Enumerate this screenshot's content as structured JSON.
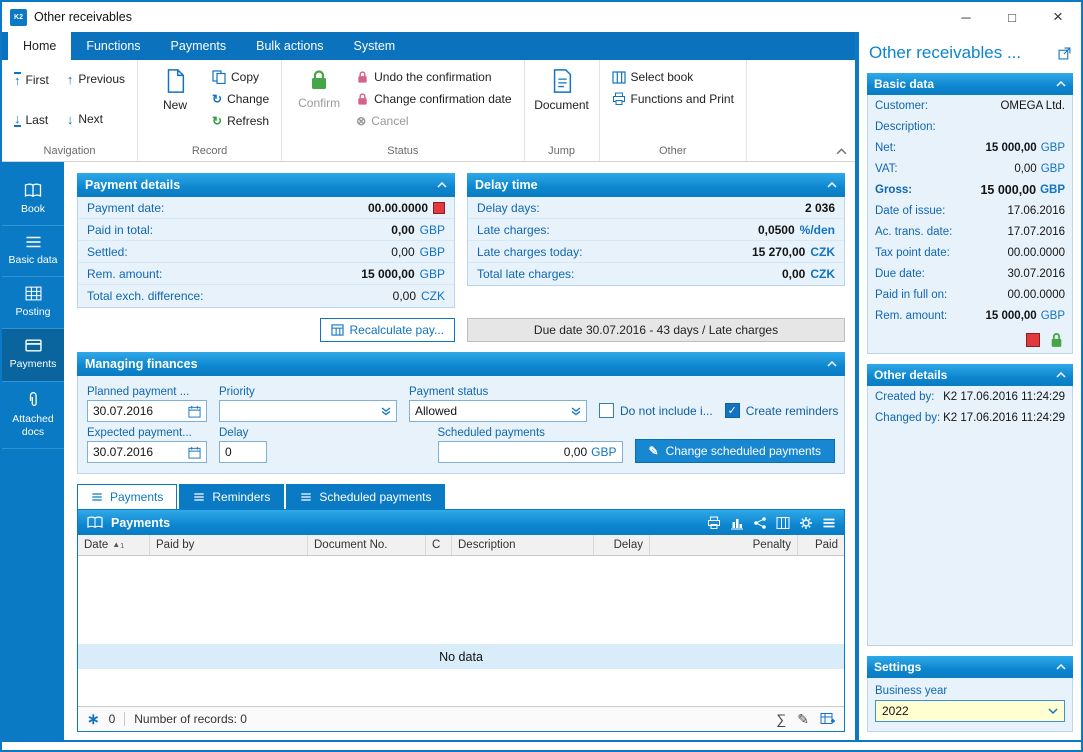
{
  "window": {
    "title": "Other receivables",
    "app_badge": "K2"
  },
  "icons": {
    "minimize": "─",
    "maximize": "□",
    "close": "×",
    "arrow_up": "↑",
    "arrow_down": "↓",
    "refresh": "↻",
    "cancel": "⊗",
    "sort_asc": "▲",
    "sigma": "∑",
    "pencil": "✎",
    "snowflake": "∗"
  },
  "menu": {
    "home": "Home",
    "functions": "Functions",
    "payments": "Payments",
    "bulk_actions": "Bulk actions",
    "system": "System"
  },
  "ribbon": {
    "navigation": {
      "label": "Navigation",
      "first": "First",
      "previous": "Previous",
      "last": "Last",
      "next": "Next"
    },
    "record": {
      "label": "Record",
      "new": "New",
      "copy": "Copy",
      "change": "Change",
      "refresh": "Refresh"
    },
    "status": {
      "label": "Status",
      "confirm": "Confirm",
      "undo": "Undo the confirmation",
      "change_date": "Change confirmation date",
      "cancel": "Cancel"
    },
    "jump": {
      "label": "Jump",
      "document": "Document"
    },
    "other": {
      "label": "Other",
      "select_book": "Select book",
      "functions_print": "Functions and Print"
    }
  },
  "sidebar": {
    "items": [
      {
        "label": "Book"
      },
      {
        "label": "Basic data"
      },
      {
        "label": "Posting"
      },
      {
        "label": "Payments"
      },
      {
        "label": "Attached docs"
      }
    ]
  },
  "payment_details": {
    "title": "Payment details",
    "payment_date": {
      "label": "Payment date:",
      "value": "00.00.0000"
    },
    "paid_in_total": {
      "label": "Paid in total:",
      "value": "0,00",
      "unit": "GBP"
    },
    "settled": {
      "label": "Settled:",
      "value": "0,00",
      "unit": "GBP"
    },
    "rem_amount": {
      "label": "Rem. amount:",
      "value": "15 000,00",
      "unit": "GBP"
    },
    "total_exch": {
      "label": "Total exch. difference:",
      "value": "0,00",
      "unit": "CZK"
    },
    "recalculate_label": "Recalculate pay..."
  },
  "delay_time": {
    "title": "Delay time",
    "delay_days": {
      "label": "Delay days:",
      "value": "2 036"
    },
    "late_charges": {
      "label": "Late charges:",
      "value": "0,0500",
      "unit": "%/den"
    },
    "late_charges_today": {
      "label": "Late charges today:",
      "value": "15 270,00",
      "unit": "CZK"
    },
    "total_late_charges": {
      "label": "Total late charges:",
      "value": "0,00",
      "unit": "CZK"
    },
    "due_banner": "Due date 30.07.2016 - 43 days / Late charges"
  },
  "managing_finances": {
    "title": "Managing finances",
    "planned_payment": {
      "label": "Planned payment ...",
      "value": "30.07.2016"
    },
    "priority": {
      "label": "Priority",
      "value": ""
    },
    "payment_status": {
      "label": "Payment status",
      "value": "Allowed"
    },
    "do_not_include": {
      "label": "Do not include i...",
      "checked": false
    },
    "create_reminders": {
      "label": "Create reminders",
      "checked": true
    },
    "expected_payment": {
      "label": "Expected payment...",
      "value": "30.07.2016"
    },
    "delay": {
      "label": "Delay",
      "value": "0"
    },
    "scheduled_payments": {
      "label": "Scheduled payments",
      "value": "0,00",
      "unit": "GBP"
    },
    "change_scheduled_label": "Change scheduled payments"
  },
  "tabs": {
    "payments": "Payments",
    "reminders": "Reminders",
    "scheduled": "Scheduled payments"
  },
  "grid": {
    "title": "Payments",
    "columns": [
      "Date",
      "Paid by",
      "Document No.",
      "C",
      "Description",
      "Delay",
      "Penalty",
      "Paid"
    ],
    "sort_order": "1",
    "empty_text": "No data",
    "footer": {
      "filter_count": "0",
      "records": "Number of records: 0"
    }
  },
  "right_panel": {
    "title": "Other receivables ...",
    "basic_data": {
      "title": "Basic data",
      "customer": {
        "label": "Customer:",
        "value": "OMEGA Ltd."
      },
      "description": {
        "label": "Description:",
        "value": ""
      },
      "net": {
        "label": "Net:",
        "value": "15 000,00",
        "unit": "GBP"
      },
      "vat": {
        "label": "VAT:",
        "value": "0,00",
        "unit": "GBP"
      },
      "gross": {
        "label": "Gross:",
        "value": "15 000,00",
        "unit": "GBP"
      },
      "date_of_issue": {
        "label": "Date of issue:",
        "value": "17.06.2016"
      },
      "ac_trans_date": {
        "label": "Ac. trans. date:",
        "value": "17.07.2016"
      },
      "tax_point_date": {
        "label": "Tax point date:",
        "value": "00.00.0000"
      },
      "due_date": {
        "label": "Due date:",
        "value": "30.07.2016"
      },
      "paid_in_full": {
        "label": "Paid in full on:",
        "value": "00.00.0000"
      },
      "rem_amount": {
        "label": "Rem. amount:",
        "value": "15 000,00",
        "unit": "GBP"
      }
    },
    "other_details": {
      "title": "Other details",
      "created_by": {
        "label": "Created by:",
        "value": "K2 17.06.2016 11:24:29"
      },
      "changed_by": {
        "label": "Changed by:",
        "value": "K2 17.06.2016 11:24:29"
      }
    },
    "settings": {
      "title": "Settings",
      "business_year": {
        "label": "Business year",
        "value": "2022"
      }
    }
  },
  "colors": {
    "accent": "#0b79c6",
    "panel_bg": "#e7f2fb",
    "alert_red": "#e0393e",
    "lock_green": "#46a546",
    "combo_yellow": "#ffffd2"
  }
}
